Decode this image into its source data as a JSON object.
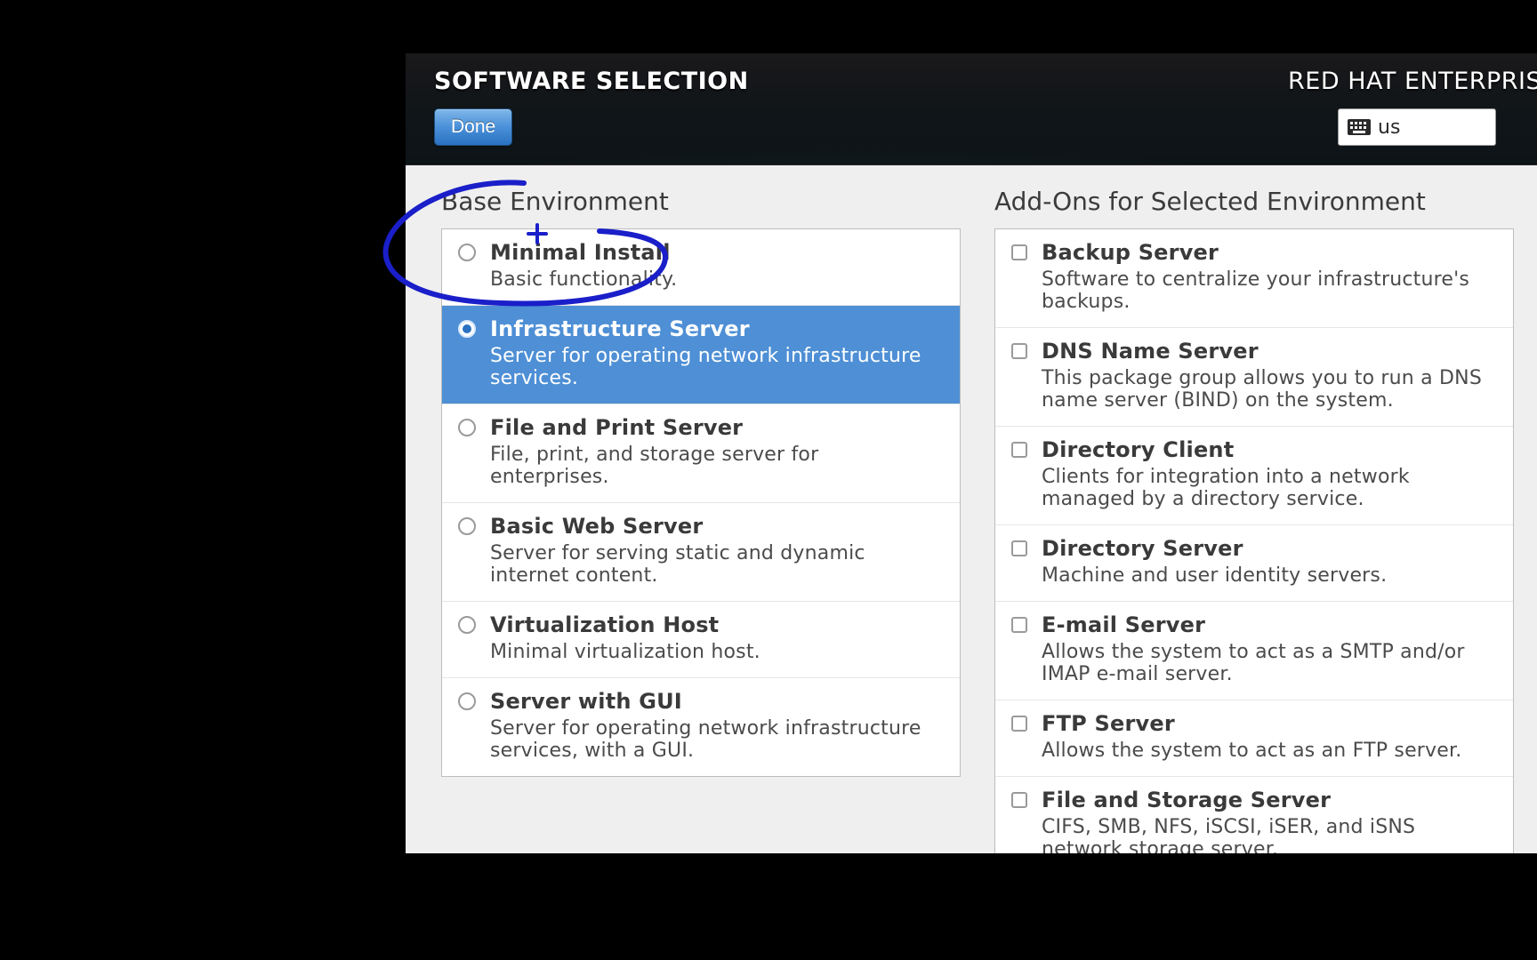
{
  "header": {
    "title": "SOFTWARE SELECTION",
    "done_label": "Done",
    "brand": "RED HAT ENTERPRISE LINUX"
  },
  "keyboard": {
    "layout": "us"
  },
  "base_env": {
    "title": "Base Environment",
    "selected_index": 1,
    "items": [
      {
        "title": "Minimal Install",
        "desc": "Basic functionality."
      },
      {
        "title": "Infrastructure Server",
        "desc": "Server for operating network infrastructure services."
      },
      {
        "title": "File and Print Server",
        "desc": "File, print, and storage server for enterprises."
      },
      {
        "title": "Basic Web Server",
        "desc": "Server for serving static and dynamic internet content."
      },
      {
        "title": "Virtualization Host",
        "desc": "Minimal virtualization host."
      },
      {
        "title": "Server with GUI",
        "desc": "Server for operating network infrastructure services, with a GUI."
      }
    ]
  },
  "addons": {
    "title": "Add-Ons for Selected Environment",
    "items": [
      {
        "title": "Backup Server",
        "desc": "Software to centralize your infrastructure's backups."
      },
      {
        "title": "DNS Name Server",
        "desc": "This package group allows you to run a DNS name server (BIND) on the system."
      },
      {
        "title": "Directory Client",
        "desc": "Clients for integration into a network managed by a directory service."
      },
      {
        "title": "Directory Server",
        "desc": "Machine and user identity servers."
      },
      {
        "title": "E-mail Server",
        "desc": "Allows the system to act as a SMTP and/or IMAP e-mail server."
      },
      {
        "title": "FTP Server",
        "desc": "Allows the system to act as an FTP server."
      },
      {
        "title": "File and Storage Server",
        "desc": "CIFS, SMB, NFS, iSCSI, iSER, and iSNS network storage server."
      }
    ]
  }
}
